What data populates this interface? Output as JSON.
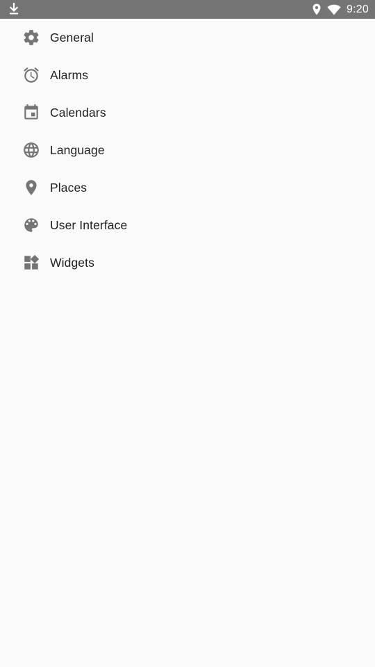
{
  "status_bar": {
    "time": "9:20",
    "left_icon": "download-icon",
    "right_icons": [
      "location-icon",
      "wifi-icon"
    ],
    "background": "#757575"
  },
  "menu": {
    "items": [
      {
        "label": "General",
        "icon": "gear-icon"
      },
      {
        "label": "Alarms",
        "icon": "alarm-clock-icon"
      },
      {
        "label": "Calendars",
        "icon": "calendar-icon"
      },
      {
        "label": "Language",
        "icon": "globe-icon"
      },
      {
        "label": "Places",
        "icon": "place-pin-icon"
      },
      {
        "label": "User Interface",
        "icon": "palette-icon"
      },
      {
        "label": "Widgets",
        "icon": "widgets-icon"
      }
    ],
    "icon_color": "#757575",
    "text_color": "#212121"
  },
  "background": "#fafafa"
}
